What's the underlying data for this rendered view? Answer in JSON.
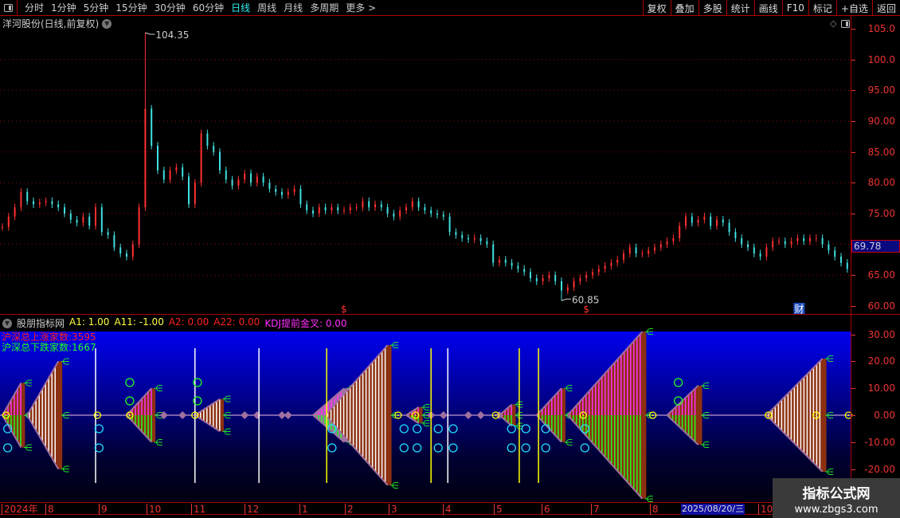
{
  "toolbar": {
    "tabs": [
      "分时",
      "1分钟",
      "5分钟",
      "15分钟",
      "30分钟",
      "60分钟",
      "日线",
      "周线",
      "月线",
      "多周期",
      "更多 >"
    ],
    "active_tab": "日线",
    "right_buttons": [
      "复权",
      "叠加",
      "多股",
      "统计",
      "画线",
      "F10",
      "标记",
      "+自选",
      "返回"
    ]
  },
  "main": {
    "title": "洋河股份(日线,前复权)",
    "current_price": "69.78",
    "axis_labels": [
      "105.0",
      "100.0",
      "95.00",
      "90.00",
      "85.00",
      "80.00",
      "75.00",
      "70.00",
      "65.00",
      "60.00"
    ],
    "markers": [
      {
        "text": "$",
        "index": 55
      },
      {
        "text": "$",
        "index": 94
      },
      {
        "text": "财",
        "index": 128
      }
    ]
  },
  "indicator": {
    "name": "股朋指标网",
    "values": [
      {
        "label": "A1: 1.00",
        "color": "#ffff40"
      },
      {
        "label": "A11: -1.00",
        "color": "#ffff40"
      },
      {
        "label": "A2: 0.00",
        "color": "#ff2020"
      },
      {
        "label": "A22: 0.00",
        "color": "#ff2020"
      },
      {
        "label": "KDJ提前金叉: 0.00",
        "color": "#ff30ff"
      }
    ],
    "up_count": "沪深总上涨家数:3595",
    "down_count": "沪深总下跌家数:1667",
    "axis_labels": [
      "30.00",
      "20.00",
      "10.00",
      "0.00",
      "-10.00",
      "-20.00"
    ]
  },
  "date_axis": {
    "labels": [
      "2024年",
      "8",
      "9",
      "10",
      "11",
      "12",
      "1",
      "2",
      "3",
      "4",
      "5",
      "6",
      "7",
      "8",
      "10"
    ],
    "current_date": "2025/08/20/三"
  },
  "watermark": {
    "line1": "指标公式网",
    "line2": "www.zbgs3.com"
  },
  "colors": {
    "up": "#ff3030",
    "down": "#40e0e0",
    "grid": "#a00000",
    "brown": "#8b3010",
    "mauve": "#a070a0"
  },
  "chart_data": [
    {
      "type": "candlestick",
      "title": "洋河股份(日线,前复权)",
      "ylim": [
        60,
        105
      ],
      "closes": [
        72.8,
        74.5,
        76,
        78.5,
        77,
        76.5,
        76.8,
        77,
        76.5,
        76,
        75,
        74,
        73.5,
        74.5,
        73,
        76,
        72,
        71.5,
        69.5,
        68.5,
        68,
        70,
        76,
        92,
        86,
        82,
        80.5,
        82,
        82.5,
        81,
        76.5,
        80,
        88,
        86,
        85,
        82,
        80.5,
        79.5,
        80.5,
        81.5,
        80,
        81,
        80,
        79,
        78.5,
        78,
        78.5,
        79,
        76.5,
        75.5,
        75,
        76,
        75.5,
        76,
        75.5,
        75.5,
        76,
        76,
        77,
        76,
        76.5,
        76,
        75,
        74.5,
        75.5,
        76,
        77,
        76,
        75.5,
        75,
        74.8,
        74.5,
        72,
        71.5,
        71,
        70.8,
        71,
        70.5,
        70,
        67,
        67.5,
        67,
        66.5,
        66,
        65.5,
        64.5,
        64,
        64.5,
        65,
        64,
        62.5,
        63,
        64,
        64.5,
        65,
        65.5,
        66,
        66.5,
        67,
        67.5,
        68.5,
        69.5,
        68.5,
        68.5,
        69,
        69.5,
        70,
        70.5,
        71,
        73,
        74.5,
        73.5,
        74,
        74.5,
        73,
        74,
        73.5,
        72,
        71,
        70,
        69.5,
        68.5,
        68,
        69.5,
        70.5,
        70.5,
        70,
        70.5,
        71,
        70.5,
        71,
        71,
        70,
        69,
        68,
        67,
        66
      ],
      "annotations": [
        {
          "label": "104.35",
          "index": 23,
          "value": 104.35
        },
        {
          "label": "60.85",
          "index": 90,
          "value": 60.85
        }
      ]
    },
    {
      "type": "indicator",
      "ylim": [
        -30,
        31
      ],
      "wedges": [
        {
          "start": 0,
          "end": 3,
          "amp": 12,
          "style": "magenta"
        },
        {
          "start": 4,
          "end": 9,
          "amp": 20,
          "style": "white"
        },
        {
          "start": 20,
          "end": 24,
          "amp": 10,
          "style": "magenta"
        },
        {
          "start": 31,
          "end": 35,
          "amp": 6,
          "style": "white"
        },
        {
          "start": 50,
          "end": 55,
          "amp": 10,
          "style": "mauve"
        },
        {
          "start": 52,
          "end": 62,
          "amp": 26,
          "style": "white"
        },
        {
          "start": 65,
          "end": 67,
          "amp": 3,
          "style": "magenta"
        },
        {
          "start": 80,
          "end": 82,
          "amp": 4,
          "style": "magenta"
        },
        {
          "start": 86,
          "end": 90,
          "amp": 10,
          "style": "magenta"
        },
        {
          "start": 91,
          "end": 103,
          "amp": 31,
          "style": "magenta"
        },
        {
          "start": 107,
          "end": 112,
          "amp": 11,
          "style": "magenta"
        },
        {
          "start": 123,
          "end": 132,
          "amp": 21,
          "style": "white"
        }
      ],
      "diamonds": [
        26,
        29,
        39,
        41,
        45,
        46,
        69,
        71,
        75,
        77,
        80
      ],
      "vlines": [
        {
          "index": 15,
          "color": "#ffffff"
        },
        {
          "index": 31,
          "color": "#ffffff"
        },
        {
          "index": 41.3,
          "color": "#ffffff"
        },
        {
          "index": 52.2,
          "color": "#ffff00"
        },
        {
          "index": 69,
          "color": "#ffff00"
        },
        {
          "index": 71.7,
          "color": "#ffffff"
        },
        {
          "index": 83.2,
          "color": "#ffff00"
        },
        {
          "index": 86.3,
          "color": "#ffff00"
        }
      ],
      "yellow_circles": [
        0.6,
        15.3,
        20.5,
        31,
        63.7,
        66.5,
        79.4,
        93.5,
        104.7,
        123.3,
        131,
        136.2
      ],
      "cyan_circles": [
        0.6,
        15.3,
        52.8,
        64.4,
        66.5,
        69.9,
        72.3,
        81.7,
        84,
        87.2,
        93.5
      ],
      "green_circles": [
        20.5,
        31.4,
        108.8
      ]
    }
  ]
}
